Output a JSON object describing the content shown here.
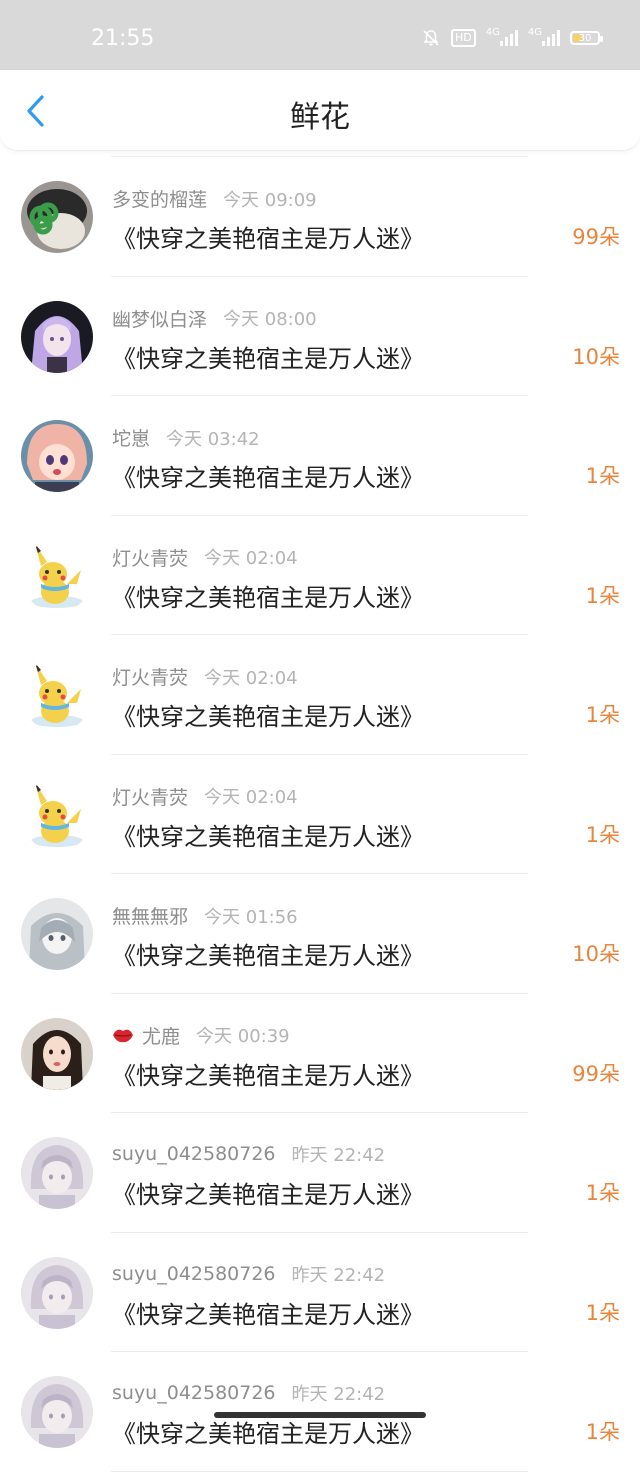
{
  "status_bar": {
    "time": "21:55",
    "hd_label": "HD",
    "network_1": "4G",
    "network_2": "4G",
    "battery": "30"
  },
  "header": {
    "title": "鲜花"
  },
  "colors": {
    "accent": "#2f9bf0",
    "count": "#e8853d",
    "name": "#8e8e8e",
    "time": "#b4b4b4"
  },
  "items": [
    {
      "user": "多变的榴莲",
      "time": "今天 09:09",
      "book": "《快穿之美艳宿主是万人迷》",
      "count": "99朵",
      "avatar": "dog-avatar"
    },
    {
      "user": "幽梦似白泽",
      "time": "今天 08:00",
      "book": "《快穿之美艳宿主是万人迷》",
      "count": "10朵",
      "avatar": "anime-purple-avatar"
    },
    {
      "user": "坨崽",
      "time": "今天 03:42",
      "book": "《快穿之美艳宿主是万人迷》",
      "count": "1朵",
      "avatar": "anime-pink-avatar"
    },
    {
      "user": "灯火青荧",
      "time": "今天 02:04",
      "book": "《快穿之美艳宿主是万人迷》",
      "count": "1朵",
      "avatar": "pikachu-avatar"
    },
    {
      "user": "灯火青荧",
      "time": "今天 02:04",
      "book": "《快穿之美艳宿主是万人迷》",
      "count": "1朵",
      "avatar": "pikachu-avatar"
    },
    {
      "user": "灯火青荧",
      "time": "今天 02:04",
      "book": "《快穿之美艳宿主是万人迷》",
      "count": "1朵",
      "avatar": "pikachu-avatar"
    },
    {
      "user": "無無無邪",
      "time": "今天 01:56",
      "book": "《快穿之美艳宿主是万人迷》",
      "count": "10朵",
      "avatar": "anime-gray-avatar"
    },
    {
      "user": "尤鹿",
      "time": "今天 00:39",
      "book": "《快穿之美艳宿主是万人迷》",
      "count": "99朵",
      "avatar": "girl-photo-avatar",
      "badge": "lips-icon"
    },
    {
      "user": "suyu_042580726",
      "time": "昨天 22:42",
      "book": "《快穿之美艳宿主是万人迷》",
      "count": "1朵",
      "avatar": "faded-anime-avatar"
    },
    {
      "user": "suyu_042580726",
      "time": "昨天 22:42",
      "book": "《快穿之美艳宿主是万人迷》",
      "count": "1朵",
      "avatar": "faded-anime-avatar"
    },
    {
      "user": "suyu_042580726",
      "time": "昨天 22:42",
      "book": "《快穿之美艳宿主是万人迷》",
      "count": "1朵",
      "avatar": "faded-anime-avatar"
    }
  ]
}
